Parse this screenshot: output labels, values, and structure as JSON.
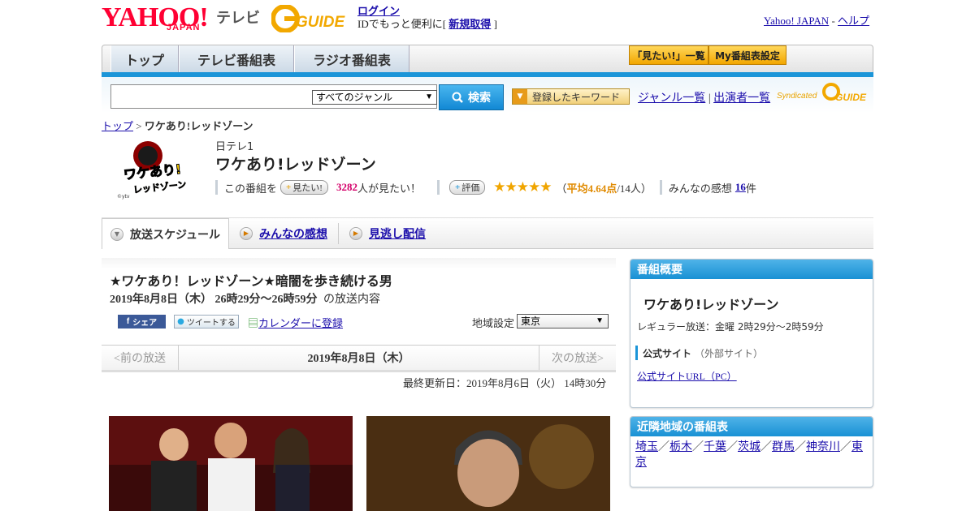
{
  "header": {
    "logo_yahoo": "YAHOO!",
    "logo_japan": "JAPAN",
    "logo_tv": "テレビ",
    "gguide_logo": "G GUIDE",
    "login_label": "ログイン",
    "login_text": "IDでもっと便利に[",
    "signup_label": "新規取得",
    "signup_suffix": " ]",
    "yahoo_japan_link": "Yahoo! JAPAN",
    "separator": " - ",
    "help_link": "ヘルプ"
  },
  "nav": {
    "tabs": [
      "トップ",
      "テレビ番組表",
      "ラジオ番組表"
    ],
    "btn_mitai_list": "「見たい!」一覧",
    "btn_my_table": "My番組表設定"
  },
  "search": {
    "genre_selected": "すべてのジャンル",
    "button_label": "検索",
    "keyword_button": "登録したキーワード",
    "genre_list_link": "ジャンル一覧",
    "divider": " | ",
    "performers_link": "出演者一覧",
    "syndicated_label": "Syndicated",
    "syndicated_logo": "G GUIDE"
  },
  "breadcrumb": {
    "top": "トップ",
    "sep": " > ",
    "current": "ワケあり!レッドゾーン"
  },
  "program": {
    "logo_text": "ワケあり! レッドゾーン",
    "logo_credit": "©ytv",
    "station": "日テレ1",
    "title": "ワケあり!レッドゾーン",
    "mitai_prefix": "この番組を",
    "mitai_pill": "見たい!",
    "mitai_count": "3282",
    "mitai_suffix": "人が見たい！",
    "rate_pill": "評価",
    "stars": "★★★★★",
    "rating_open": "（",
    "rating_avg": "平均4.64点",
    "rating_count": "/14人）",
    "comments_label": "みんなの感想",
    "comments_count": "16",
    "comments_unit": "件"
  },
  "tabs": {
    "schedule": "放送スケジュール",
    "impressions": "みんなの感想",
    "catchup": "見逃し配信"
  },
  "episode": {
    "title": "★ワケあり！レッドゾーン★暗闇を歩き続ける男",
    "date_time": "2019年8月8日（木）  26時29分～26時59分",
    "date_suffix": "の放送内容",
    "share_fb": "シェア",
    "tweet": "ツイートする",
    "calendar": "カレンダーに登録",
    "region_label": "地域設定",
    "region_value": "東京",
    "prev": "<前の放送",
    "current_date": "2019年8月8日（木）",
    "next": "次の放送>",
    "updated": "最終更新日：2019年8月6日（火） 14時30分"
  },
  "overview": {
    "header": "番組概要",
    "title": "ワケあり!レッドゾーン",
    "regular": "レギュラー放送：金曜 2時29分～2時59分",
    "official_site": "公式サイト",
    "external": "（外部サイト）",
    "official_url": "公式サイトURL（PC）"
  },
  "nearby": {
    "header": "近隣地域の番組表",
    "regions": [
      "埼玉",
      "栃木",
      "千葉",
      "茨城",
      "群馬",
      "神奈川",
      "東京"
    ],
    "sep": "／"
  }
}
